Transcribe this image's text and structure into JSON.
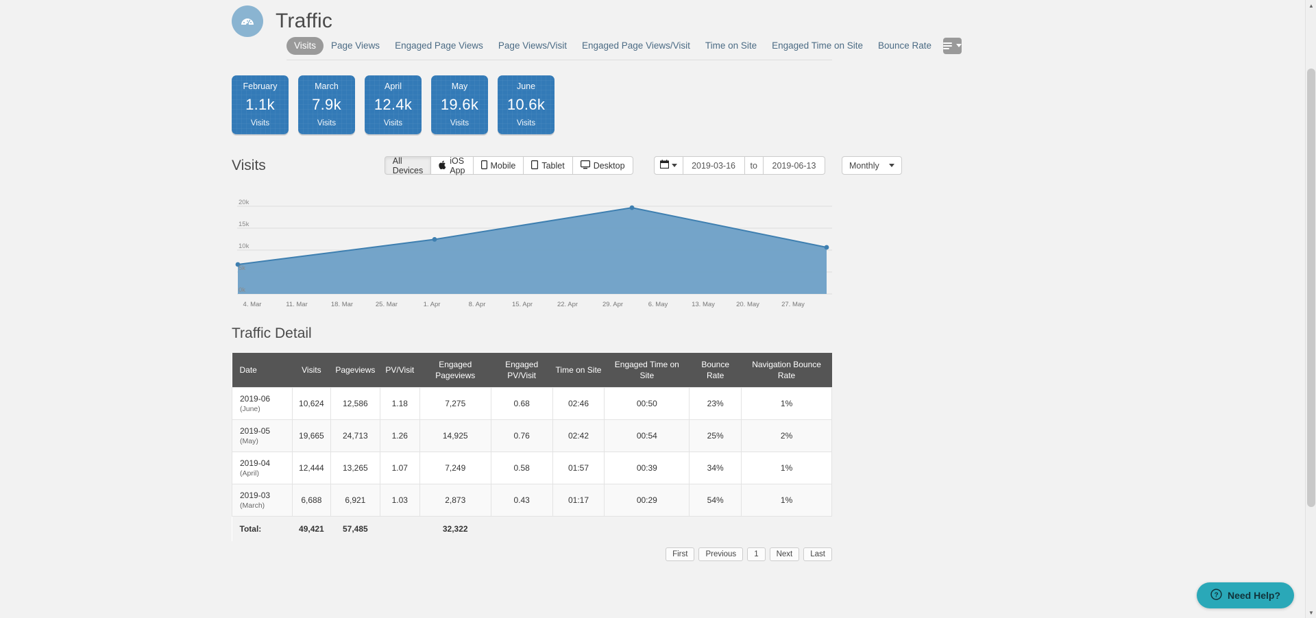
{
  "header": {
    "title": "Traffic",
    "icon": "speedometer-icon"
  },
  "tabs": [
    {
      "label": "Visits",
      "active": true
    },
    {
      "label": "Page Views",
      "active": false
    },
    {
      "label": "Engaged Page Views",
      "active": false
    },
    {
      "label": "Page Views/Visit",
      "active": false
    },
    {
      "label": "Engaged Page Views/Visit",
      "active": false
    },
    {
      "label": "Time on Site",
      "active": false
    },
    {
      "label": "Engaged Time on Site",
      "active": false
    },
    {
      "label": "Bounce Rate",
      "active": false
    }
  ],
  "tab_overflow_icon": "hamburger-menu-icon",
  "kpis": [
    {
      "month": "February",
      "value": "1.1k",
      "label": "Visits"
    },
    {
      "month": "March",
      "value": "7.9k",
      "label": "Visits"
    },
    {
      "month": "April",
      "value": "12.4k",
      "label": "Visits"
    },
    {
      "month": "May",
      "value": "19.6k",
      "label": "Visits"
    },
    {
      "month": "June",
      "value": "10.6k",
      "label": "Visits"
    }
  ],
  "chart_section": {
    "title": "Visits",
    "devices": [
      {
        "label": "All Devices",
        "icon": "",
        "active": true
      },
      {
        "label": "iOS App",
        "icon": "apple-icon",
        "active": false
      },
      {
        "label": "Mobile",
        "icon": "mobile-icon",
        "active": false
      },
      {
        "label": "Tablet",
        "icon": "tablet-icon",
        "active": false
      },
      {
        "label": "Desktop",
        "icon": "desktop-icon",
        "active": false
      }
    ],
    "calendar_icon": "calendar-icon",
    "date_from": "2019-03-16",
    "date_to_label": "to",
    "date_to": "2019-06-13",
    "granularity": "Monthly"
  },
  "chart_data": {
    "type": "area",
    "title": "Visits",
    "xlabel": "",
    "ylabel": "",
    "ylim": [
      0,
      20000
    ],
    "yticks": [
      0,
      5000,
      10000,
      15000,
      20000
    ],
    "ytick_labels": [
      "0k",
      "5k",
      "10k",
      "15k",
      "20k"
    ],
    "xtick_labels": [
      "4. Mar",
      "11. Mar",
      "18. Mar",
      "25. Mar",
      "1. Apr",
      "8. Apr",
      "15. Apr",
      "22. Apr",
      "29. Apr",
      "6. May",
      "13. May",
      "20. May",
      "27. May"
    ],
    "grid": true,
    "legend": "none",
    "series": [
      {
        "name": "Visits",
        "color": "#6d9fc6",
        "line_color": "#3e7fb0",
        "points": [
          {
            "x": "2019-03-16",
            "y": 6688
          },
          {
            "x": "2019-04-01",
            "y": 12444
          },
          {
            "x": "2019-05-01",
            "y": 19665
          },
          {
            "x": "2019-06-01",
            "y": 10624
          }
        ]
      }
    ]
  },
  "detail": {
    "title": "Traffic Detail",
    "columns": [
      "Date",
      "Visits",
      "Pageviews",
      "PV/Visit",
      "Engaged Pageviews",
      "Engaged PV/Visit",
      "Time on Site",
      "Engaged Time on Site",
      "Bounce Rate",
      "Navigation Bounce Rate"
    ],
    "rows": [
      {
        "date": "2019-06",
        "month": "(June)",
        "visits": "10,624",
        "pageviews": "12,586",
        "pv_visit": "1.18",
        "eng_pageviews": "7,275",
        "eng_pv_visit": "0.68",
        "time_on_site": "02:46",
        "eng_time_on_site": "00:50",
        "bounce": "23%",
        "nav_bounce": "1%"
      },
      {
        "date": "2019-05",
        "month": "(May)",
        "visits": "19,665",
        "pageviews": "24,713",
        "pv_visit": "1.26",
        "eng_pageviews": "14,925",
        "eng_pv_visit": "0.76",
        "time_on_site": "02:42",
        "eng_time_on_site": "00:54",
        "bounce": "25%",
        "nav_bounce": "2%"
      },
      {
        "date": "2019-04",
        "month": "(April)",
        "visits": "12,444",
        "pageviews": "13,265",
        "pv_visit": "1.07",
        "eng_pageviews": "7,249",
        "eng_pv_visit": "0.58",
        "time_on_site": "01:57",
        "eng_time_on_site": "00:39",
        "bounce": "34%",
        "nav_bounce": "1%"
      },
      {
        "date": "2019-03",
        "month": "(March)",
        "visits": "6,688",
        "pageviews": "6,921",
        "pv_visit": "1.03",
        "eng_pageviews": "2,873",
        "eng_pv_visit": "0.43",
        "time_on_site": "01:17",
        "eng_time_on_site": "00:29",
        "bounce": "54%",
        "nav_bounce": "1%"
      }
    ],
    "total": {
      "label": "Total:",
      "visits": "49,421",
      "pageviews": "57,485",
      "pv_visit": "",
      "eng_pageviews": "32,322"
    }
  },
  "pagination": [
    {
      "label": "First"
    },
    {
      "label": "Previous"
    },
    {
      "label": "1"
    },
    {
      "label": "Next"
    },
    {
      "label": "Last"
    }
  ],
  "need_help": {
    "label": "Need Help?",
    "icon": "question-circle-icon",
    "color": "#2aa8b8"
  }
}
